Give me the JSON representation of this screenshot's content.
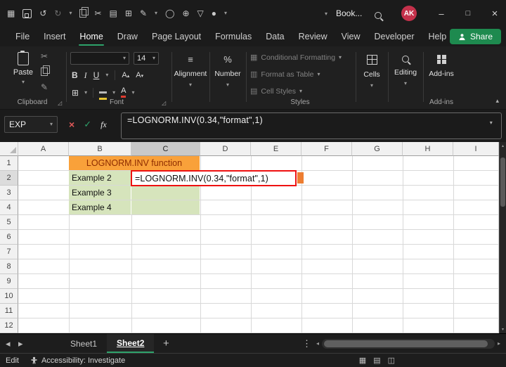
{
  "window": {
    "doc_title": "Book...",
    "avatar_initials": "AK",
    "controls": {
      "minimize": "–",
      "maximize": "□",
      "close": "×"
    }
  },
  "title_bar": {
    "quick_access": [
      {
        "name": "app-launcher",
        "glyph": "▦"
      },
      {
        "name": "save"
      },
      {
        "name": "undo",
        "glyph": "↺"
      },
      {
        "name": "redo",
        "glyph": "↻"
      },
      {
        "name": "quick-access-chevron",
        "glyph": "▾"
      },
      {
        "name": "copy"
      },
      {
        "name": "cut",
        "glyph": "✂"
      },
      {
        "name": "picture",
        "glyph": "▤"
      },
      {
        "name": "table",
        "glyph": "⊞"
      },
      {
        "name": "draw",
        "glyph": "✎"
      },
      {
        "name": "draw-chevron",
        "glyph": "▾"
      },
      {
        "name": "shape",
        "glyph": "◯"
      },
      {
        "name": "zoom",
        "glyph": "⊕"
      },
      {
        "name": "filter",
        "glyph": "▽"
      },
      {
        "name": "record",
        "glyph": "●"
      },
      {
        "name": "record-chevron",
        "glyph": "▾"
      }
    ],
    "search_icon": "search"
  },
  "menu": {
    "items": [
      "File",
      "Insert",
      "Home",
      "Draw",
      "Page Layout",
      "Formulas",
      "Data",
      "Review",
      "View",
      "Developer",
      "Help"
    ],
    "active_item": "Home",
    "share": "Share"
  },
  "ribbon": {
    "paste_label": "Paste",
    "font_name": "",
    "font_size": "14",
    "bold_label": "B",
    "italic_label": "I",
    "underline_label": "U",
    "styles_items": [
      "Conditional Formatting",
      "Format as Table",
      "Cell Styles"
    ],
    "collapsed_groups": [
      "Alignment",
      "Number",
      "Cells",
      "Editing"
    ],
    "addins_label": "Add-ins",
    "group_labels": {
      "clipboard": "Clipboard",
      "font": "Font",
      "styles": "Styles",
      "addins": "Add-ins"
    }
  },
  "formula_bar": {
    "name_box_value": "EXP",
    "cancel_glyph": "×",
    "enter_glyph": "✓",
    "fx_label": "fx",
    "formula": "=LOGNORM.INV(0.34,\"format\",1)"
  },
  "grid": {
    "columns": [
      "A",
      "B",
      "C",
      "D",
      "E",
      "F",
      "G",
      "H",
      "I"
    ],
    "rows": [
      "1",
      "2",
      "3",
      "4",
      "5",
      "6",
      "7",
      "8",
      "9",
      "10",
      "11",
      "12"
    ],
    "cells": {
      "header": "LOGNORM.INV function",
      "example2": "Example 2",
      "example3": "Example 3",
      "example4": "Example 4",
      "c2_formula": "=LOGNORM.INV(0.34,\"format\",1)"
    }
  },
  "sheet_bar": {
    "prev_glyph": "◂",
    "next_glyph": "▸",
    "tabs": [
      "Sheet1",
      "Sheet2"
    ],
    "active_tab": "Sheet2",
    "add_label": "+",
    "menu_glyph": "⋮"
  },
  "status_bar": {
    "mode_label": "Edit",
    "accessibility_label": "Accessibility: Investigate",
    "view_icons": [
      {
        "name": "normal-view",
        "glyph": "▦"
      },
      {
        "name": "page-layout-view",
        "glyph": "▤"
      },
      {
        "name": "page-break-view",
        "glyph": "◫"
      }
    ]
  },
  "colors": {
    "excel_green": "#1e8a4f",
    "tab_underline": "#2ea36b",
    "title_fill": "#f9a13a",
    "title_text": "#8e2c00",
    "range_fill": "#d6e4bc",
    "edit_border": "#ee1111",
    "fill_handle": "#ed7d31",
    "avatar_bg": "#c4314b"
  }
}
